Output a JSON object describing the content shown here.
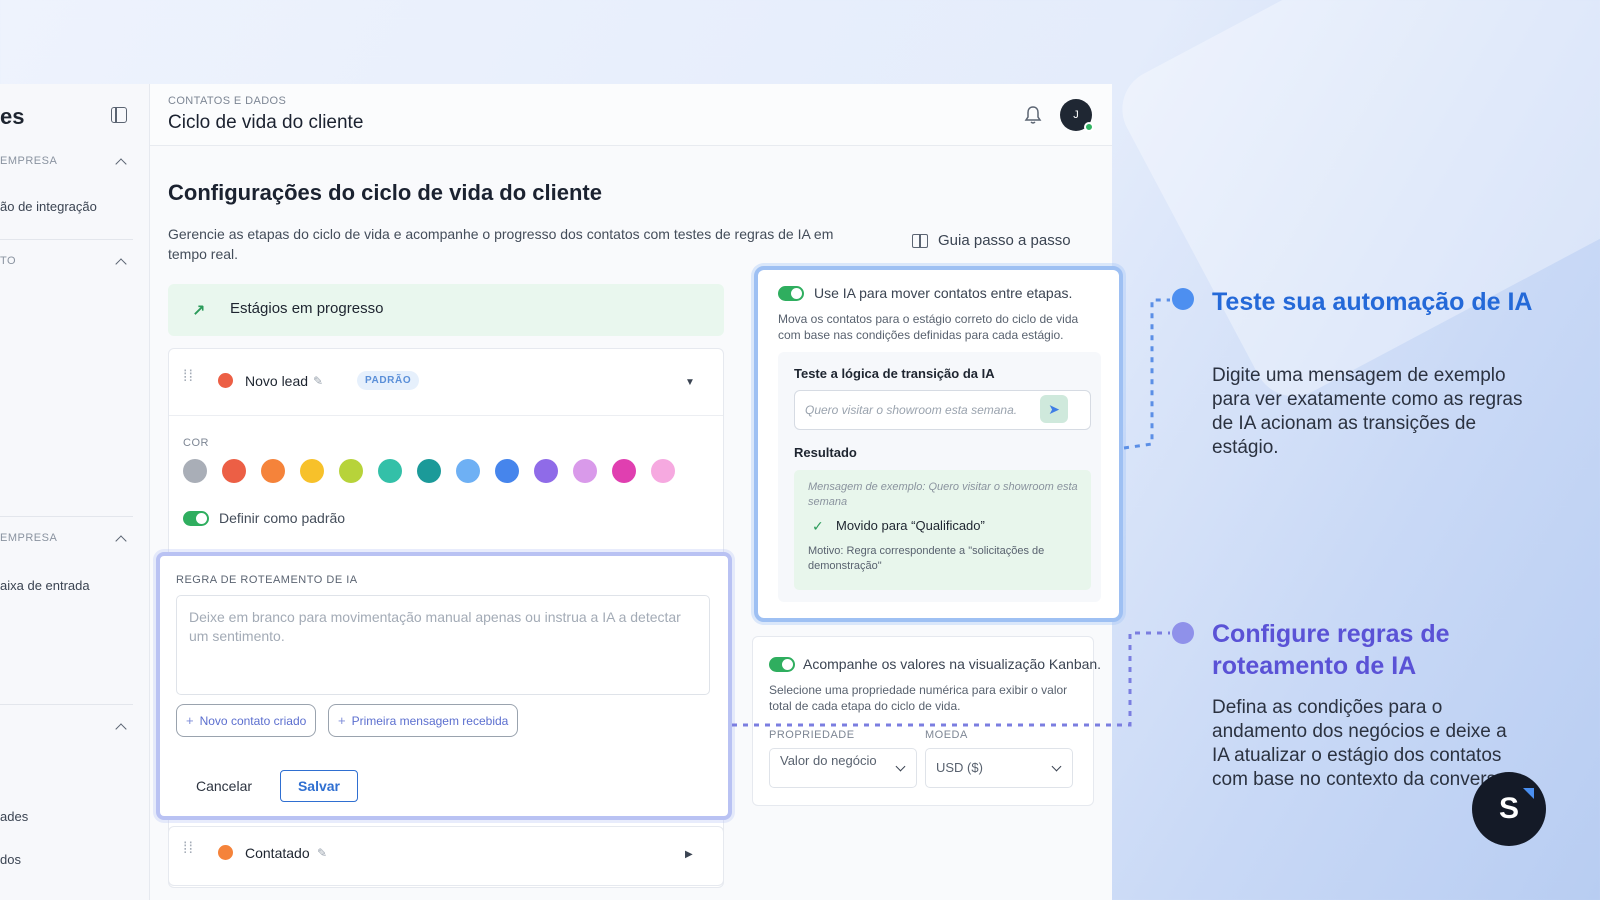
{
  "sidebar": {
    "title": "es",
    "sections": [
      "EMPRESA",
      "TO",
      "EMPRESA"
    ],
    "items": [
      "ão de integração",
      "aixa de entrada",
      "ades",
      "dos"
    ]
  },
  "header": {
    "breadcrumb": "CONTATOS E DADOS",
    "title": "Ciclo de vida do cliente",
    "avatar_initial": "J"
  },
  "main": {
    "heading": "Configurações do ciclo de vida do cliente",
    "description": "Gerencie as etapas do ciclo de vida e acompanhe o progresso dos contatos com testes de regras de IA em tempo real.",
    "guide_label": "Guia passo a passo",
    "stages_banner": "Estágios em progresso",
    "stage1": {
      "name": "Novo lead",
      "badge": "PADRÃO",
      "color": "#ec5f45"
    },
    "color_label": "COR",
    "swatches": [
      "#a9aeb7",
      "#ec5f45",
      "#f5833a",
      "#f7c12a",
      "#b7d33a",
      "#33c0a8",
      "#1b9a99",
      "#6eb0f4",
      "#4685ec",
      "#8f6be8",
      "#d99aea",
      "#e03fb0",
      "#f6a9e0"
    ],
    "default_toggle_label": "Definir como padrão",
    "stage2": {
      "name": "Contatado",
      "color": "#f5833a"
    }
  },
  "rule": {
    "title": "REGRA DE ROTEAMENTO DE IA",
    "placeholder": "Deixe em branco para movimentação manual apenas ou instrua a IA a detectar um sentimento.",
    "chips": [
      "Novo contato criado",
      "Primeira mensagem recebida"
    ],
    "cancel": "Cancelar",
    "save": "Salvar"
  },
  "ai_test": {
    "toggle_label": "Use IA para mover contatos entre etapas.",
    "description": "Mova os contatos para o estágio correto do ciclo de vida com base nas condições definidas para cada estágio.",
    "section_title": "Teste a lógica de transição da IA",
    "input_placeholder": "Quero visitar o showroom esta semana.",
    "result_title": "Resultado",
    "example": "Mensagem de exemplo: Quero visitar o showroom esta semana",
    "moved": "Movido para “Qualificado”",
    "reason": "Motivo: Regra correspondente a \"solicitações de demonstração\""
  },
  "kanban": {
    "toggle_label": "Acompanhe os valores na visualização Kanban.",
    "description": "Selecione uma propriedade numérica para exibir o valor total de cada etapa do ciclo de vida.",
    "property_label": "PROPRIEDADE",
    "currency_label": "MOEDA",
    "property_value": "Valor do negócio",
    "currency_value": "USD ($)"
  },
  "callouts": {
    "test_title": "Teste sua automação de IA",
    "test_body": "Digite uma mensagem de exemplo para ver exatamente como as regras de IA acionam as transições de estágio.",
    "rules_title": "Configure regras de roteamento de IA",
    "rules_body": "Defina as condições para o andamento dos negócios e deixe a IA atualizar o estágio dos contatos com base no contexto da conversa."
  },
  "logo_letter": "S",
  "colors": {
    "accent_blue": "#2469d8",
    "accent_purple": "#5a52d6",
    "toggle_green": "#2fae5f"
  }
}
